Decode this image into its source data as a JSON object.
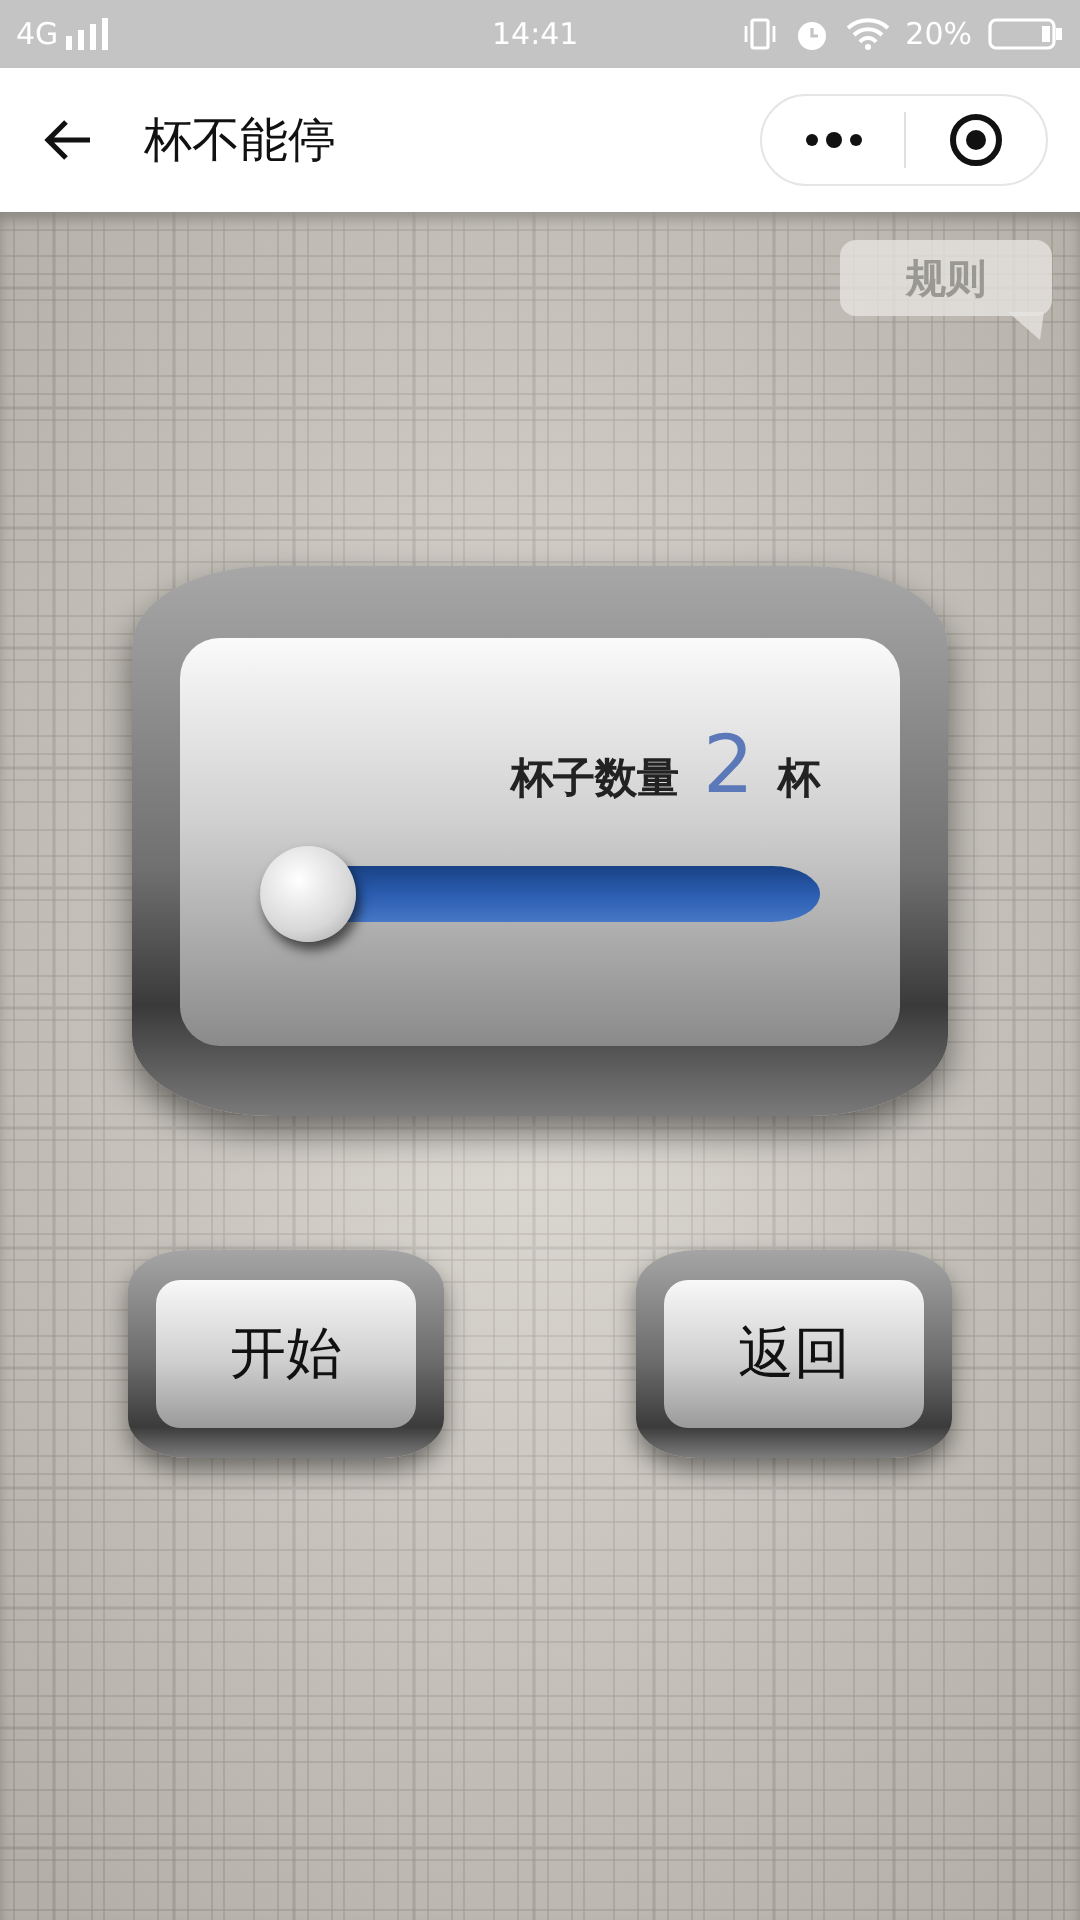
{
  "status_bar": {
    "network": "4G",
    "time": "14:41",
    "battery": "20%"
  },
  "nav_bar": {
    "title": "杯不能停"
  },
  "rules_button": {
    "label": "规则"
  },
  "cup_panel": {
    "label": "杯子数量",
    "count": "2",
    "unit": "杯",
    "slider": {
      "level": 0
    }
  },
  "buttons": [
    {
      "label": "开始"
    },
    {
      "label": "返回"
    }
  ]
}
